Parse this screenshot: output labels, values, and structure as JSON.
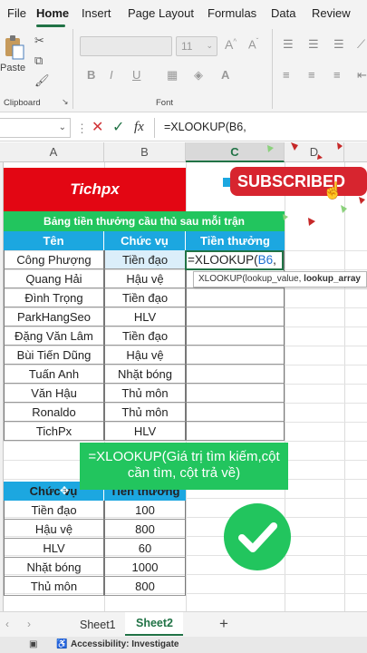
{
  "ribbon_tabs": [
    "File",
    "Home",
    "Insert",
    "Page Layout",
    "Formulas",
    "Data",
    "Review"
  ],
  "ribbon": {
    "paste_label": "Paste",
    "clipboard_label": "Clipboard",
    "font_label": "Font",
    "font_size": "11",
    "bold": "B",
    "italic": "I",
    "underline": "U"
  },
  "formula_bar": {
    "fx": "fx",
    "formula": "=XLOOKUP(B6,"
  },
  "columns": [
    "A",
    "B",
    "C",
    "D"
  ],
  "sheet": {
    "title": "Tichpx",
    "subtitle": "Bảng tiền thưởng cầu thủ sau mỗi trận",
    "headers": [
      "Tên",
      "Chức vụ",
      "Tiền thưởng"
    ],
    "rows": [
      {
        "name": "Công Phượng",
        "role": "Tiền đạo"
      },
      {
        "name": "Quang Hải",
        "role": "Hậu vệ"
      },
      {
        "name": "Đình Trọng",
        "role": "Tiền đạo"
      },
      {
        "name": "ParkHangSeo",
        "role": "HLV"
      },
      {
        "name": "Đặng Văn Lâm",
        "role": "Tiền đạo"
      },
      {
        "name": "Bùi Tiến Dũng",
        "role": "Hậu vệ"
      },
      {
        "name": "Tuấn Anh",
        "role": "Nhặt bóng"
      },
      {
        "name": "Văn Hậu",
        "role": "Thủ môn"
      },
      {
        "name": "Ronaldo",
        "role": "Thủ môn"
      },
      {
        "name": "TichPx",
        "role": "HLV"
      }
    ],
    "editing_cell": "=XLOOKUP(B6,",
    "editing_ref": "B6",
    "lookup_headers": [
      "Chức vụ",
      "Tiền thưởng"
    ],
    "lookup_rows": [
      {
        "role": "Tiền đạo",
        "bonus": "100"
      },
      {
        "role": "Hậu vệ",
        "bonus": "800"
      },
      {
        "role": "HLV",
        "bonus": "60"
      },
      {
        "role": "Nhặt bóng",
        "bonus": "1000"
      },
      {
        "role": "Thủ môn",
        "bonus": "800"
      }
    ]
  },
  "tooltip": {
    "text_a": "XLOOKUP(lookup_value, ",
    "text_b": "lookup_array"
  },
  "overlay_text": "=XLOOKUP(Giá trị tìm kiếm,cột cần tìm, cột trả về)",
  "subscribe_label": "SUBSCRIBED",
  "sheets": [
    "Sheet1",
    "Sheet2"
  ],
  "add_sheet": "+",
  "status": {
    "accessibility": "Accessibility: Investigate"
  },
  "colors": {
    "title_red": "#e30613",
    "header_blue": "#1ca7e0",
    "banner_green": "#22c55e",
    "excel_green": "#217346"
  }
}
